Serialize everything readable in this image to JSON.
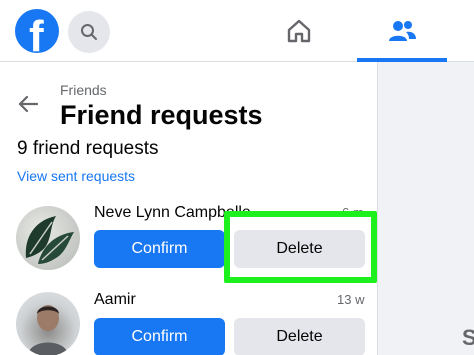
{
  "topbar": {
    "logo": "f",
    "icons": {
      "search": "search-icon",
      "home": "home-icon",
      "friends": "friends-icon"
    },
    "accent": "#1877f2"
  },
  "sidebar": {
    "breadcrumb": "Friends",
    "title": "Friend requests",
    "count_text": "9 friend requests",
    "view_sent": "View sent requests"
  },
  "requests": [
    {
      "name": "Neve Lynn Campbelle",
      "time": "6 m",
      "confirm_label": "Confirm",
      "delete_label": "Delete"
    },
    {
      "name": "Aamir",
      "time": "13 w",
      "confirm_label": "Confirm",
      "delete_label": "Delete"
    }
  ],
  "right_pane": {
    "letter": "S"
  },
  "colors": {
    "highlight": "#1ef01e",
    "confirm_bg": "#1877f2",
    "delete_bg": "#e4e6eb"
  }
}
